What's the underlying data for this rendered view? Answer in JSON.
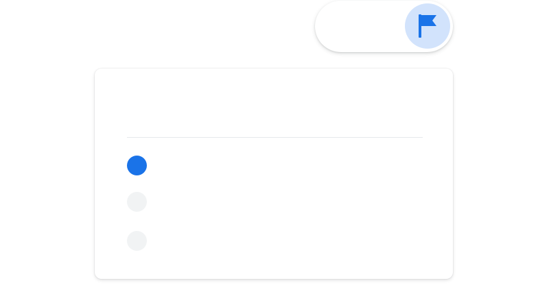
{
  "flag": {
    "icon": "flag-icon",
    "button_bg": "#d2e3fc",
    "icon_color": "#1a73e8"
  },
  "options": [
    {
      "selected": true,
      "color": "#1a73e8"
    },
    {
      "selected": false,
      "color": "#f1f3f4"
    },
    {
      "selected": false,
      "color": "#f1f3f4"
    }
  ],
  "colors": {
    "accent": "#1a73e8",
    "divider": "#e6e8eb",
    "unselected": "#f1f3f4"
  }
}
